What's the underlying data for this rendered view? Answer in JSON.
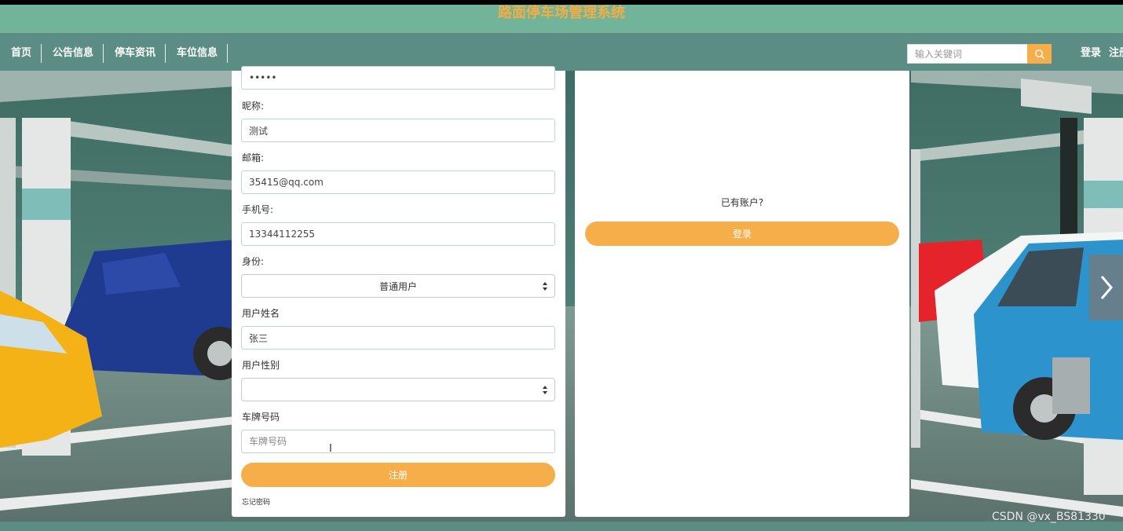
{
  "header": {
    "site_title": "路面停车场管理系统"
  },
  "nav": {
    "items": [
      {
        "label": "首页"
      },
      {
        "label": "公告信息"
      },
      {
        "label": "停车资讯"
      },
      {
        "label": "车位信息"
      }
    ],
    "search": {
      "placeholder": "输入关键词",
      "icon": "search-icon"
    },
    "login_label": "登录",
    "register_label": "注册"
  },
  "register_form": {
    "password": {
      "value": "•••••"
    },
    "nickname": {
      "label": "昵称:",
      "value": "测试"
    },
    "email": {
      "label": "邮箱:",
      "value": "35415@qq.com"
    },
    "phone": {
      "label": "手机号:",
      "value": "13344112255"
    },
    "role": {
      "label": "身份:",
      "selected": "普通用户"
    },
    "username": {
      "label": "用户姓名",
      "value": "张三"
    },
    "gender": {
      "label": "用户性别",
      "selected": ""
    },
    "plate": {
      "label": "车牌号码",
      "placeholder": "车牌号码",
      "value": ""
    },
    "submit_label": "注册",
    "forgot_label": "忘记密码",
    "cursor_glyph": "I"
  },
  "login_panel": {
    "prompt": "已有账户?",
    "button_label": "登录"
  },
  "carousel": {
    "next_icon": "chevron-right-icon"
  },
  "watermark": "CSDN @vx_BS81330",
  "colors": {
    "accent": "#f6ae4a",
    "title_bar": "#72b49a",
    "nav_bar": "#5b8d84",
    "title_text": "#f3ad43"
  }
}
